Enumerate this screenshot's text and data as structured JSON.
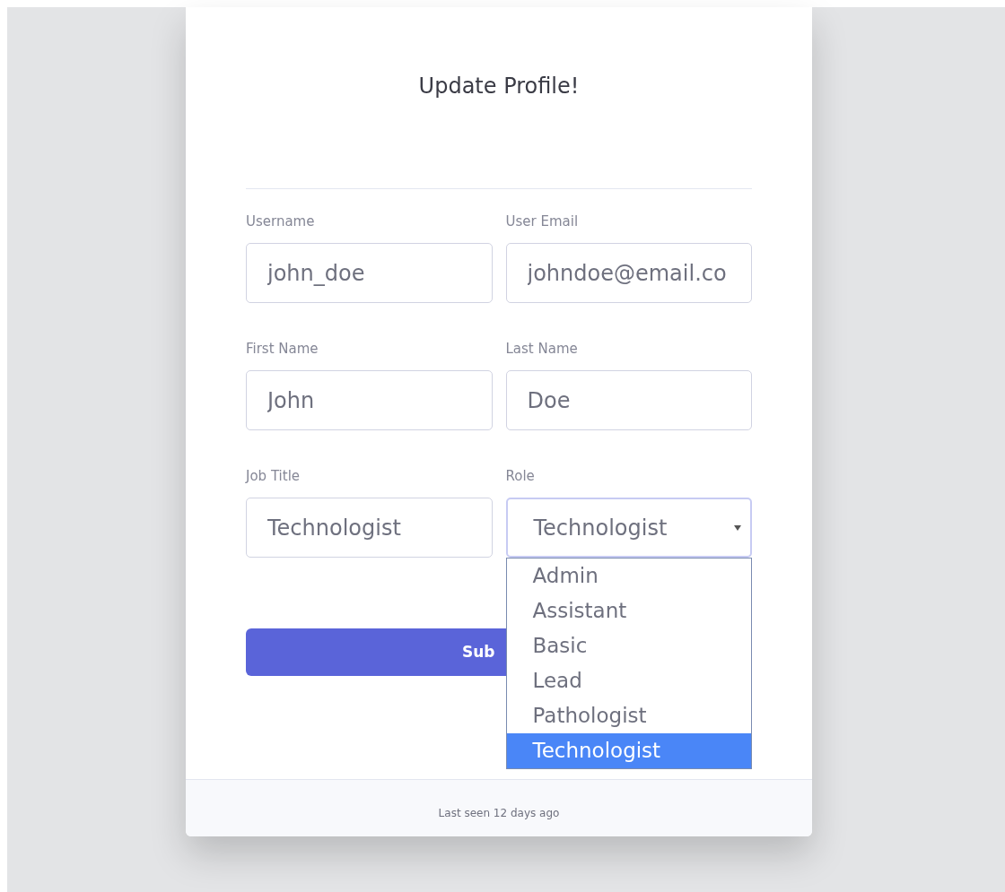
{
  "title": "Update Profile!",
  "fields": [
    {
      "label": "Username",
      "value": "john_doe",
      "kind": "text"
    },
    {
      "label": "User Email",
      "value": "johndoe@email.co",
      "kind": "text"
    },
    {
      "label": "First Name",
      "value": "John",
      "kind": "text"
    },
    {
      "label": "Last Name",
      "value": "Doe",
      "kind": "text"
    },
    {
      "label": "Job Title",
      "value": "Technologist",
      "kind": "text"
    },
    {
      "label": "Role",
      "value": "Technologist",
      "kind": "select",
      "expanded": true,
      "options": [
        {
          "label": "Admin",
          "selected": false
        },
        {
          "label": "Assistant",
          "selected": false
        },
        {
          "label": "Basic",
          "selected": false
        },
        {
          "label": "Lead",
          "selected": false
        },
        {
          "label": "Pathologist",
          "selected": false
        },
        {
          "label": "Technologist",
          "selected": true
        }
      ]
    }
  ],
  "submit_button": "Sub",
  "footer": "Last seen 12 days ago"
}
